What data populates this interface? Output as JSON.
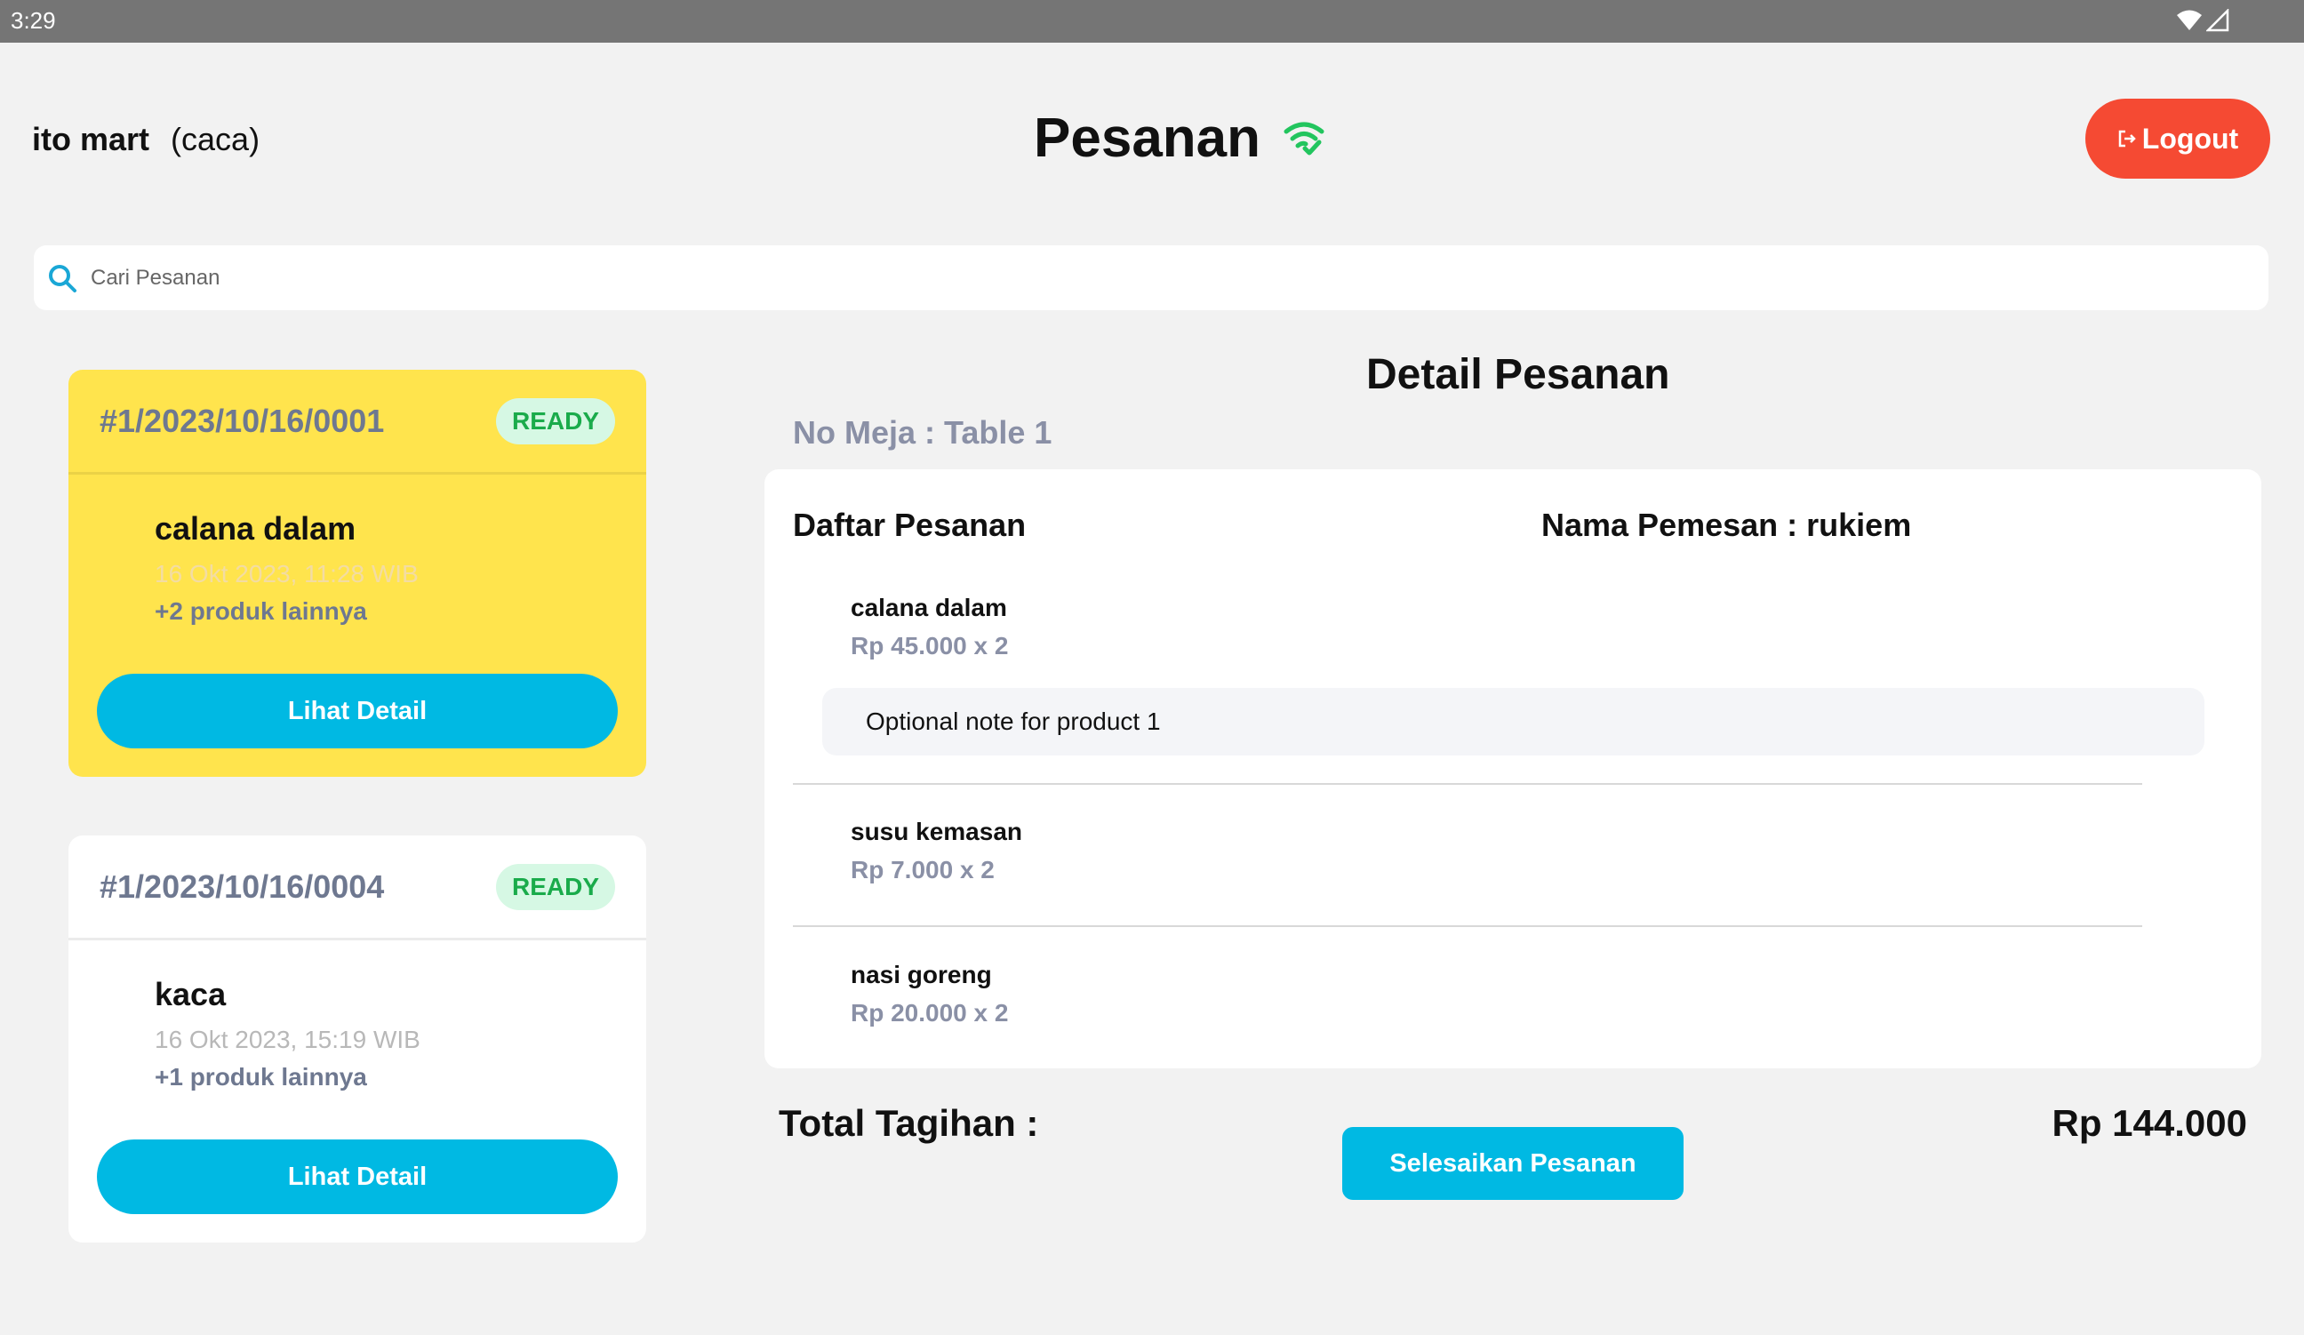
{
  "status_bar": {
    "time": "3:29",
    "icons": [
      "wifi-icon",
      "signal-icon"
    ]
  },
  "header": {
    "store_name": "ito mart",
    "user": "(caca)",
    "title": "Pesanan",
    "title_icon": "wifi-check-icon",
    "logout_label": "Logout",
    "logout_icon": "logout-icon"
  },
  "search": {
    "placeholder": "Cari Pesanan",
    "icon": "search-icon"
  },
  "orders": [
    {
      "order_no": "#1/2023/10/16/0001",
      "status": "READY",
      "product": "calana dalam",
      "date": "16 Okt 2023, 11:28 WIB",
      "more": "+2 produk lainnya",
      "button": "Lihat Detail",
      "selected": true
    },
    {
      "order_no": "#1/2023/10/16/0004",
      "status": "READY",
      "product": "kaca",
      "date": "16 Okt 2023, 15:19 WIB",
      "more": "+1 produk lainnya",
      "button": "Lihat Detail",
      "selected": false
    }
  ],
  "detail": {
    "title": "Detail Pesanan",
    "table": "No Meja : Table 1",
    "list_title": "Daftar Pesanan",
    "customer": "Nama Pemesan : rukiem",
    "items": [
      {
        "name": "calana dalam",
        "price": "Rp 45.000 x 2",
        "note": "Optional note for product 1"
      },
      {
        "name": "susu kemasan",
        "price": "Rp 7.000 x 2"
      },
      {
        "name": "nasi goreng",
        "price": "Rp 20.000 x 2"
      }
    ],
    "total_label": "Total Tagihan :",
    "total_value": "Rp 144.000",
    "finish_button": "Selesaikan Pesanan"
  },
  "colors": {
    "accent": "#00b9e3",
    "logout": "#f54a33",
    "selected_card": "#ffe44d",
    "ready_badge_bg": "#d6f8e4",
    "ready_badge_text": "#1aab4b",
    "online_icon": "#22c55e"
  }
}
